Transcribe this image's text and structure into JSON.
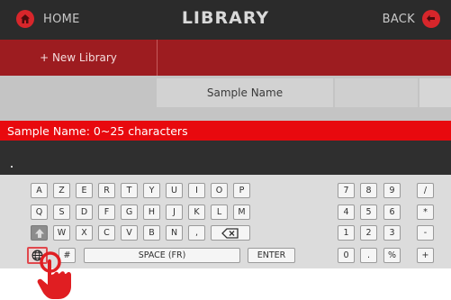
{
  "header": {
    "home_label": "HOME",
    "title": "LIBRARY",
    "back_label": "BACK"
  },
  "toolbar": {
    "new_library_label": "+ New Library"
  },
  "table": {
    "column_header": "Sample Name"
  },
  "hint": {
    "text": "Sample Name: 0~25 characters"
  },
  "input": {
    "value": ""
  },
  "keyboard": {
    "row1": [
      "A",
      "Z",
      "E",
      "R",
      "T",
      "Y",
      "U",
      "I",
      "O",
      "P"
    ],
    "row2": [
      "Q",
      "S",
      "D",
      "F",
      "G",
      "H",
      "J",
      "K",
      "L",
      "M"
    ],
    "row3": [
      "W",
      "X",
      "C",
      "V",
      "B",
      "N",
      ","
    ],
    "hash": "#",
    "space_label": "SPACE (FR)",
    "enter_label": "ENTER",
    "numpad": [
      [
        "7",
        "8",
        "9",
        "/"
      ],
      [
        "4",
        "5",
        "6",
        "*"
      ],
      [
        "1",
        "2",
        "3",
        "-"
      ],
      [
        "0",
        ".",
        "%",
        "+"
      ]
    ]
  },
  "colors": {
    "accent_red": "#d7262b",
    "header_bg": "#2b2b2b",
    "hint_red": "#e8090e",
    "toolbar_red": "#9d1c20"
  }
}
